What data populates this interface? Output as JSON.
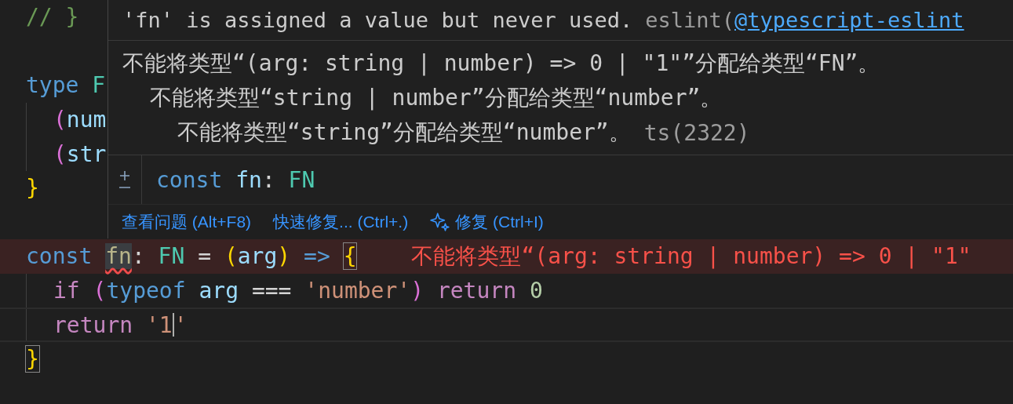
{
  "editor": {
    "lines": [
      {
        "error": false,
        "current": false,
        "indented": false,
        "tokens": [
          {
            "text": "// }",
            "kind": "comment"
          }
        ]
      },
      {
        "error": false,
        "current": false,
        "indented": false
      },
      {
        "error": false,
        "current": false,
        "indented": false,
        "tokens": [
          {
            "text": "type ",
            "kind": "keyword"
          },
          {
            "text": "F",
            "kind": "type"
          }
        ]
      },
      {
        "error": false,
        "current": false,
        "indented": true,
        "tokens": [
          {
            "text": "(",
            "kind": "paren"
          },
          {
            "text": "num",
            "kind": "variable"
          }
        ]
      },
      {
        "error": false,
        "current": false,
        "indented": true,
        "tokens": [
          {
            "text": "(",
            "kind": "paren"
          },
          {
            "text": "str",
            "kind": "variable"
          }
        ]
      },
      {
        "error": false,
        "current": false,
        "indented": false,
        "tokens": [
          {
            "text": "}",
            "kind": "brace"
          }
        ]
      },
      {
        "error": false,
        "current": false,
        "indented": false
      },
      {
        "error": true,
        "current": false,
        "indented": false,
        "tokens": [
          {
            "text": "const ",
            "kind": "keyword"
          },
          {
            "text": "fn",
            "kind": "error_identifier"
          },
          {
            "text": ": ",
            "kind": "plain"
          },
          {
            "text": "FN",
            "kind": "type"
          },
          {
            "text": " = ",
            "kind": "plain"
          },
          {
            "text": "(",
            "kind": "brace"
          },
          {
            "text": "arg",
            "kind": "variable"
          },
          {
            "text": ")",
            "kind": "brace"
          },
          {
            "text": " => ",
            "kind": "keyword"
          },
          {
            "text": "{",
            "kind": "matched_brace"
          },
          {
            "text": "不能将类型“(arg: string | number) => 0 | \"1\"",
            "kind": "inline_error"
          }
        ]
      },
      {
        "error": false,
        "current": false,
        "indented": true,
        "tokens": [
          {
            "text": "if ",
            "kind": "control"
          },
          {
            "text": "(",
            "kind": "paren"
          },
          {
            "text": "typeof ",
            "kind": "keyword"
          },
          {
            "text": "arg",
            "kind": "variable"
          },
          {
            "text": " === ",
            "kind": "plain"
          },
          {
            "text": "'number'",
            "kind": "string"
          },
          {
            "text": ")",
            "kind": "paren"
          },
          {
            "text": " return ",
            "kind": "control"
          },
          {
            "text": "0",
            "kind": "number"
          }
        ]
      },
      {
        "error": false,
        "current": true,
        "indented": true,
        "tokens": [
          {
            "text": "return ",
            "kind": "control"
          },
          {
            "text": "'1",
            "kind": "string"
          },
          {
            "kind": "caret"
          },
          {
            "text": "'",
            "kind": "string"
          }
        ]
      },
      {
        "error": false,
        "current": false,
        "indented": false,
        "tokens": [
          {
            "text": "}",
            "kind": "matched_brace"
          }
        ]
      }
    ]
  },
  "hover": {
    "eslint": {
      "message": "'fn' is assigned a value but never used.",
      "source": "eslint(",
      "rule_link": "@typescript-eslint"
    },
    "ts": {
      "text": "不能将类型“(arg: string | number) => 0 | \"1\"”分配给类型“FN”。",
      "children": [
        {
          "text": "不能将类型“string | number”分配给类型“number”。",
          "children": [
            {
              "text": "不能将类型“string”分配给类型“number”。",
              "code": "ts(2322)"
            }
          ]
        }
      ]
    },
    "signature": [
      {
        "text": "const ",
        "kind": "keyword"
      },
      {
        "text": "fn",
        "kind": "variable"
      },
      {
        "text": ": ",
        "kind": "plain"
      },
      {
        "text": "FN",
        "kind": "type"
      }
    ],
    "actions": [
      {
        "label": "查看问题 (Alt+F8)",
        "kind": "link"
      },
      {
        "label": "快速修复... (Ctrl+.)",
        "kind": "link"
      },
      {
        "label": "修复 (Ctrl+I)",
        "kind": "ai"
      }
    ]
  }
}
